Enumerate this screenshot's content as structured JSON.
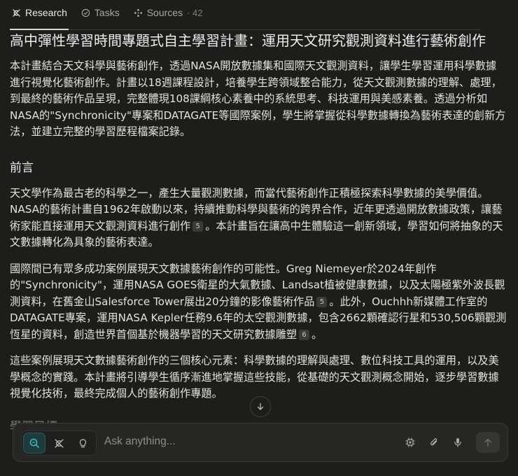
{
  "tabs": [
    {
      "label": "Research",
      "icon": "research-icon",
      "active": true
    },
    {
      "label": "Tasks",
      "icon": "check-circle-icon"
    },
    {
      "label": "Sources",
      "icon": "sources-icon",
      "count": "· 42"
    }
  ],
  "doc": {
    "title": "高中彈性學習時間專題式自主學習計畫：運用天文研究觀測資料進行藝術創作",
    "intro": "本計畫結合天文科學與藝術創作，透過NASA開放數據集和國際天文觀測資料，讓學生學習運用科學數據進行視覺化藝術創作。計畫以18週課程設計，培養學生跨領域整合能力，從天文觀測數據的理解、處理，到最終的藝術作品呈現，完整體現108課綱核心素養中的系統思考、科技運用與美感素養。透過分析如NASA的\"Synchronicity\"專案和DATAGATE等國際案例，學生將掌握從科學數據轉換為藝術表達的創新方法，並建立完整的學習歷程檔案記錄。",
    "section1_heading": "前言",
    "p1a": "天文學作為最古老的科學之一，產生大量觀測數據，而當代藝術創作正積極探索科學數據的美學價值。NASA的藝術計畫自1962年啟動以來，持續推動科學與藝術的跨界合作，近年更透過開放數據政策，讓藝術家能直接運用天文觀測資料進行創作",
    "p1_cite": "5",
    "p1b": "。本計畫旨在讓高中生體驗這一創新領域，學習如何將抽象的天文數據轉化為具象的藝術表達。",
    "p2a": "國際間已有眾多成功案例展現天文數據藝術創作的可能性。Greg Niemeyer於2024年創作的\"Synchronicity\"，運用NASA GOES衛星的大氣數據、Landsat植被健康數據，以及太陽極紫外波長觀測資料，在舊金山Salesforce Tower展出20分鐘的影像藝術作品",
    "p2_cite1": "5",
    "p2b": "。此外，Ouchhh新媒體工作室的DATAGATE專案，運用NASA Kepler任務9.6年的太空觀測數據，包含2662顆確認行星和530,506顆觀測恆星的資料，創造世界首個基於機器學習的天文研究數據雕塑",
    "p2_cite2": "6",
    "p2c": "。",
    "p3": "這些案例展現天文數據藝術創作的三個核心元素：科學數據的理解與處理、數位科技工具的運用，以及美學概念的實踐。本計畫將引導學生循序漸進地掌握這些技能，從基礎的天文觀測概念開始，逐步學習數據視覺化技術，最終完成個人的藝術創作專題。",
    "section2_heading": "學習目標"
  },
  "composer": {
    "placeholder": "Ask anything..."
  },
  "colors": {
    "background": "#1d1d1c",
    "accent": "#2e5a5c"
  }
}
